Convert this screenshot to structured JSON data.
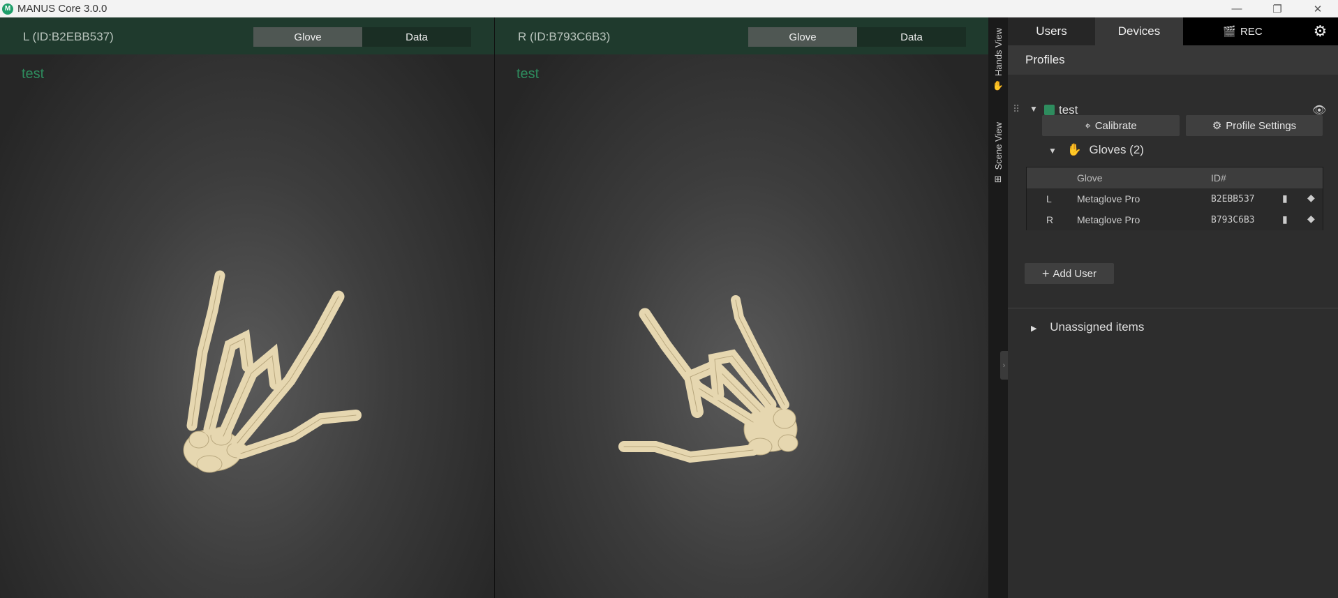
{
  "window": {
    "title": "MANUS Core 3.0.0",
    "logo_letter": "M",
    "controls": {
      "minimize": "—",
      "restore": "❐",
      "close": "✕"
    }
  },
  "views": {
    "left": {
      "id_label": "L (ID:B2EBB537)",
      "profile": "test",
      "tabs": [
        "Glove",
        "Data"
      ],
      "active_tab": "Glove"
    },
    "right": {
      "id_label": "R (ID:B793C6B3)",
      "profile": "test",
      "tabs": [
        "Glove",
        "Data"
      ],
      "active_tab": "Glove"
    }
  },
  "side_tabs": [
    {
      "label": "Hands View",
      "icon": "hand-icon"
    },
    {
      "label": "Scene View",
      "icon": "scene-icon"
    }
  ],
  "panel": {
    "tabs": {
      "users": "Users",
      "devices": "Devices",
      "rec": "REC"
    },
    "section_title": "Profiles",
    "user": {
      "name": "test"
    },
    "buttons": {
      "calibrate": "Calibrate",
      "profile_settings": "Profile Settings",
      "add_user": "Add User"
    },
    "gloves": {
      "label": "Gloves (2)",
      "columns": [
        "Glove",
        "ID#"
      ],
      "rows": [
        {
          "side": "L",
          "model": "Metaglove Pro",
          "id": "B2EBB537"
        },
        {
          "side": "R",
          "model": "Metaglove Pro",
          "id": "B793C6B3"
        }
      ]
    },
    "unassigned": "Unassigned items"
  },
  "colors": {
    "accent_green": "#2e8c5e",
    "header_green": "#1f3a2d",
    "bone": "#e6d7b0"
  }
}
